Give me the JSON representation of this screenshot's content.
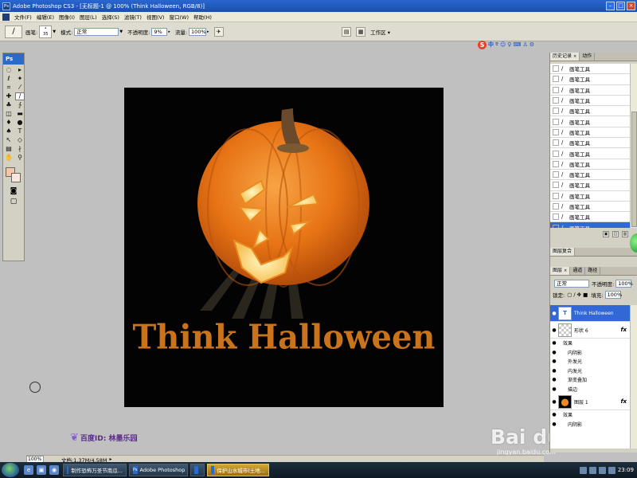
{
  "window": {
    "title": "Adobe Photoshop CS3 - [无标题-1 @ 100% (Think Halloween, RGB/8)]"
  },
  "menu": [
    "文件(F)",
    "编辑(E)",
    "图像(I)",
    "图层(L)",
    "选择(S)",
    "滤镜(T)",
    "视图(V)",
    "窗口(W)",
    "帮助(H)"
  ],
  "options": {
    "brush_label": "画笔:",
    "brush_size": "35",
    "mode_label": "模式:",
    "mode_value": "正常",
    "opacity_label": "不透明度:",
    "opacity_value": "9%",
    "flow_label": "流量:",
    "flow_value": "100%",
    "workspace_label": "工作区"
  },
  "sogou": {
    "logo": "S",
    "items": [
      "中",
      "º",
      "☺",
      "♀",
      "⌨",
      "♙",
      "⚙"
    ]
  },
  "toolbox": {
    "logo": "Ps",
    "foreground_color": "#f6c4a6",
    "background_color": "#fbe5df",
    "tools": [
      {
        "icon": "marquee-icon",
        "glyph": "◌"
      },
      {
        "icon": "move-icon",
        "glyph": "▸"
      },
      {
        "icon": "lasso-icon",
        "glyph": "ℓ"
      },
      {
        "icon": "magic-wand-icon",
        "glyph": "✦"
      },
      {
        "icon": "crop-icon",
        "glyph": "⌗"
      },
      {
        "icon": "slice-icon",
        "glyph": "⁄"
      },
      {
        "icon": "healing-icon",
        "glyph": "✚"
      },
      {
        "icon": "brush-icon",
        "glyph": "∕"
      },
      {
        "icon": "stamp-icon",
        "glyph": "♣"
      },
      {
        "icon": "history-brush-icon",
        "glyph": "∱"
      },
      {
        "icon": "eraser-icon",
        "glyph": "◫"
      },
      {
        "icon": "gradient-icon",
        "glyph": "▬"
      },
      {
        "icon": "blur-icon",
        "glyph": "♦"
      },
      {
        "icon": "dodge-icon",
        "glyph": "●"
      },
      {
        "icon": "pen-icon",
        "glyph": "♠"
      },
      {
        "icon": "type-icon",
        "glyph": "T"
      },
      {
        "icon": "path-select-icon",
        "glyph": "↖"
      },
      {
        "icon": "shape-icon",
        "glyph": "◇"
      },
      {
        "icon": "notes-icon",
        "glyph": "▤"
      },
      {
        "icon": "eyedropper-icon",
        "glyph": "∤"
      },
      {
        "icon": "hand-icon",
        "glyph": "✋"
      },
      {
        "icon": "zoom-icon",
        "glyph": "⚲"
      }
    ],
    "quickmask_glyph": "◙",
    "screenmode_glyph": "▢"
  },
  "document": {
    "canvas_text": "Think Halloween",
    "pumpkin_color": "#ea7a18",
    "text_color": "#c9731d"
  },
  "watermarks": {
    "baidu_id": "百度ID: 林墨乐园",
    "baidu_logo": "Bai du 经验",
    "baidu_url": "jingyan.baidu.com"
  },
  "statusbar": {
    "zoom": "100%",
    "doc_info": "文档:1.37M/4.58M"
  },
  "history_panel": {
    "tabs": [
      "历史记录",
      "动作"
    ],
    "rows": [
      "画笔工具",
      "画笔工具",
      "画笔工具",
      "画笔工具",
      "画笔工具",
      "画笔工具",
      "画笔工具",
      "画笔工具",
      "画笔工具",
      "画笔工具",
      "画笔工具",
      "画笔工具",
      "画笔工具",
      "画笔工具",
      "画笔工具",
      "画笔工具"
    ]
  },
  "navigator_tab": "图层复合",
  "layers_panel": {
    "tabs": [
      "图层",
      "通道",
      "路径"
    ],
    "blend_mode": "正常",
    "opacity_label": "不透明度:",
    "opacity_value": "100%",
    "lock_label": "锁定:",
    "fill_label": "填充:",
    "fill_value": "100%",
    "layers": [
      {
        "name": "Think Halloween",
        "type": "text",
        "selected": true,
        "fx": false
      },
      {
        "name": "形状 6",
        "type": "shape",
        "selected": false,
        "fx": true,
        "effects_label": "效果",
        "effects": [
          "内阴影",
          "外发光",
          "内发光",
          "渐变叠加",
          "描边"
        ]
      },
      {
        "name": "图层 1",
        "type": "pumpkin",
        "selected": false,
        "fx": true,
        "effects_label": "效果",
        "effects": [
          "内阴影"
        ]
      }
    ]
  },
  "taskbar": {
    "tasks": [
      {
        "label": "制作恐怖万圣节南瓜...",
        "active": false
      },
      {
        "label": "Adobe Photoshop ...",
        "active": false
      },
      {
        "label": "",
        "active": false
      },
      {
        "label": "保护山水城市(土地...",
        "active": true
      }
    ],
    "clock": "23:09"
  }
}
